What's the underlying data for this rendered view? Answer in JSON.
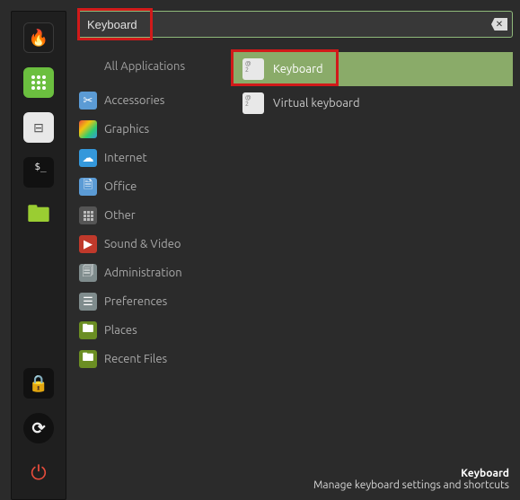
{
  "search": {
    "value": "Keyboard"
  },
  "favorites": [
    {
      "name": "firefox",
      "glyph": "🔥"
    },
    {
      "name": "applications",
      "glyph": ""
    },
    {
      "name": "disks",
      "glyph": "⊟"
    },
    {
      "name": "terminal",
      "glyph": "$_"
    },
    {
      "name": "files",
      "glyph": "🖿"
    }
  ],
  "session": [
    {
      "name": "lock",
      "glyph": "🔒"
    },
    {
      "name": "update",
      "glyph": "⟳"
    },
    {
      "name": "power",
      "glyph": "⏻"
    }
  ],
  "categories": [
    {
      "key": "all",
      "label": "All Applications"
    },
    {
      "key": "accessories",
      "label": "Accessories",
      "glyph": "✂"
    },
    {
      "key": "graphics",
      "label": "Graphics",
      "glyph": ""
    },
    {
      "key": "internet",
      "label": "Internet",
      "glyph": "☁"
    },
    {
      "key": "office",
      "label": "Office",
      "glyph": "🗎"
    },
    {
      "key": "other",
      "label": "Other",
      "glyph": ""
    },
    {
      "key": "sound",
      "label": "Sound & Video",
      "glyph": "▶"
    },
    {
      "key": "administration",
      "label": "Administration",
      "glyph": "🗐"
    },
    {
      "key": "preferences",
      "label": "Preferences",
      "glyph": "☰"
    },
    {
      "key": "places",
      "label": "Places",
      "glyph": "🖿"
    },
    {
      "key": "recent",
      "label": "Recent Files",
      "glyph": "🖿"
    }
  ],
  "results": [
    {
      "label": "Keyboard",
      "selected": true
    },
    {
      "label": "Virtual keyboard",
      "selected": false
    }
  ],
  "footer": {
    "title": "Keyboard",
    "description": "Manage keyboard settings and shortcuts"
  },
  "highlight": {
    "color": "#d11a1a"
  }
}
